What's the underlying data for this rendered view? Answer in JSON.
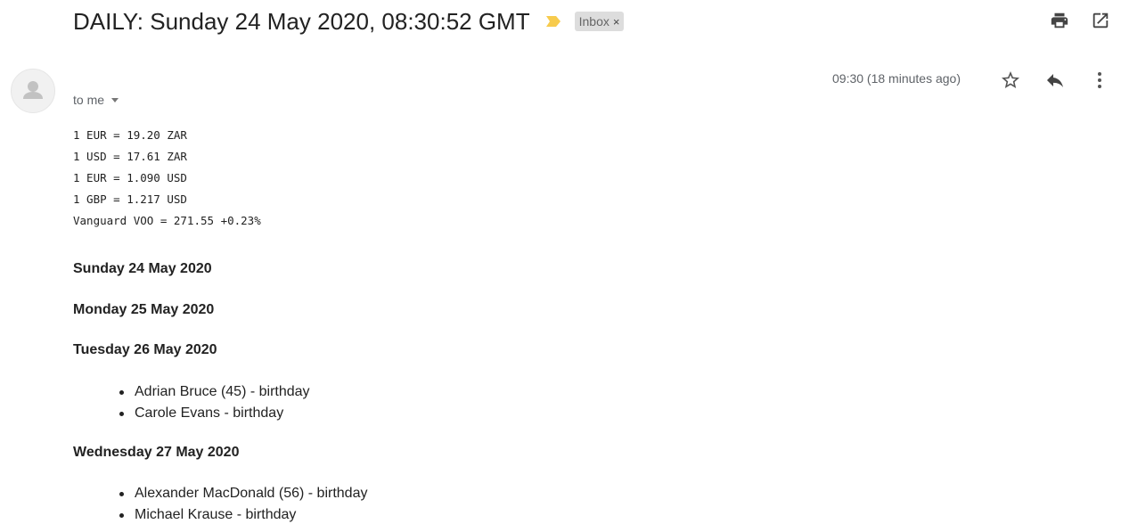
{
  "subject": "DAILY: Sunday 24 May 2020, 08:30:52 GMT",
  "label": {
    "text": "Inbox",
    "remove": "×"
  },
  "colors": {
    "importance_marker": "#f7cb4d",
    "label_bg": "#dddddd",
    "muted_text": "#5f6368"
  },
  "icons": {
    "importance": "importance-marker-icon",
    "label_remove": "close-icon",
    "print": "print-icon",
    "popout": "open-in-new-window-icon",
    "avatar": "default-avatar-icon",
    "recipient_caret": "caret-down-icon",
    "star": "star-outline-icon",
    "reply": "reply-icon",
    "more": "more-vertical-icon"
  },
  "message": {
    "recipient": "to me",
    "timestamp": "09:30 (18 minutes ago)"
  },
  "rates": [
    "1 EUR = 19.20 ZAR",
    "1 USD = 17.61 ZAR",
    "1 EUR = 1.090 USD",
    "1 GBP = 1.217 USD",
    "Vanguard VOO = 271.55 +0.23%"
  ],
  "days": [
    {
      "heading": "Sunday 24 May 2020",
      "events": []
    },
    {
      "heading": "Monday 25 May 2020",
      "events": []
    },
    {
      "heading": "Tuesday 26 May 2020",
      "events": [
        "Adrian Bruce (45) - birthday",
        "Carole Evans - birthday"
      ]
    },
    {
      "heading": "Wednesday 27 May 2020",
      "events": [
        "Alexander MacDonald (56) - birthday",
        "Michael Krause - birthday"
      ]
    }
  ]
}
